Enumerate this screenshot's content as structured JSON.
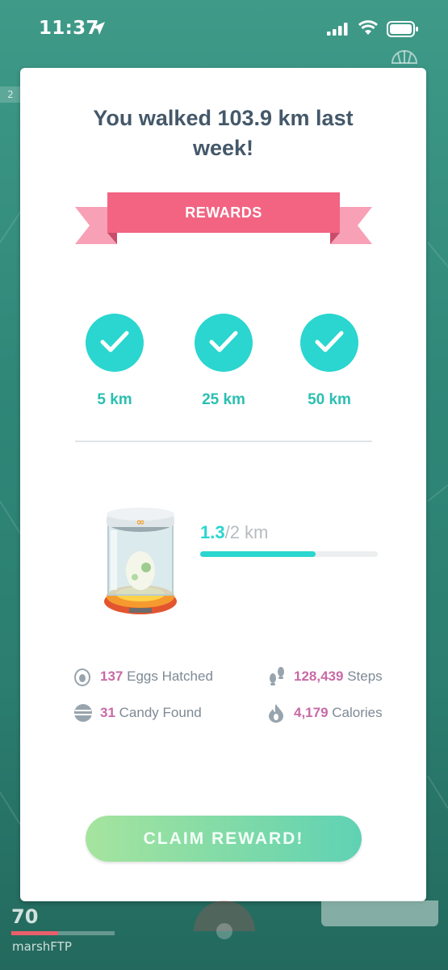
{
  "status_bar": {
    "time": "11:37"
  },
  "card": {
    "title": "You walked 103.9 km last week!",
    "ribbon_label": "REWARDS",
    "milestones": [
      {
        "label": "5 km",
        "completed": true
      },
      {
        "label": "25 km",
        "completed": true
      },
      {
        "label": "50 km",
        "completed": true
      }
    ],
    "egg_progress": {
      "current": "1.3",
      "total": "/2 km",
      "fraction": 0.65
    },
    "stats": {
      "eggs": {
        "value": "137",
        "label": "Eggs Hatched"
      },
      "steps": {
        "value": "128,439",
        "label": "Steps"
      },
      "candy": {
        "value": "31",
        "label": "Candy Found"
      },
      "calories": {
        "value": "4,179",
        "label": "Calories"
      }
    },
    "claim_button": "CLAIM REWARD!"
  },
  "background": {
    "level": "70",
    "username": "marshFTP",
    "badge": "2"
  },
  "colors": {
    "accent_teal": "#2ad6cf",
    "ribbon_pink": "#f26482",
    "stat_value": "#c86aa6",
    "title": "#44586a"
  }
}
